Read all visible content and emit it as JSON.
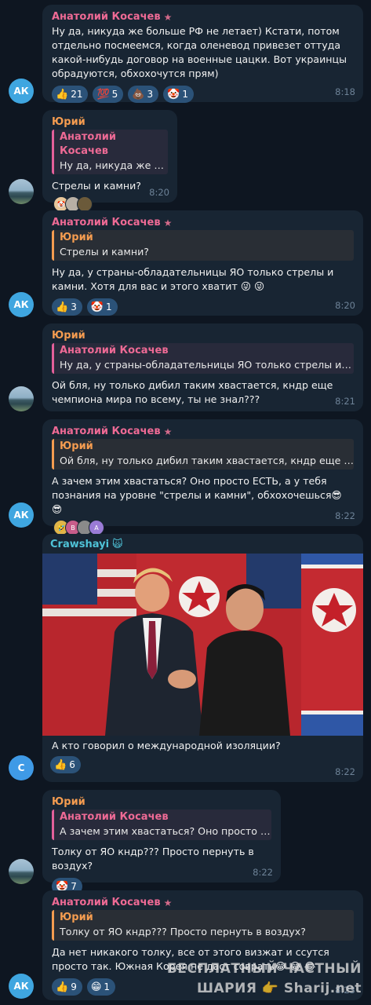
{
  "messages": [
    {
      "sender": "Анатолий Косачев",
      "avatar": "АК",
      "text": "Ну да, никуда же больше РФ не летает) Кстати, потом отдельно посмеемся, когда оленевод привезет оттуда какой-нибудь договор на военные цацки. Вот украинцы обрадуются, обхохочутся прям)",
      "reactions": [
        {
          "emoji": "👍",
          "count": "21"
        },
        {
          "emoji": "💯",
          "count": "5"
        },
        {
          "emoji": "💩",
          "count": "3"
        },
        {
          "emoji": "🤡",
          "count": "1"
        }
      ],
      "time": "8:18"
    },
    {
      "sender": "Юрий",
      "quote": {
        "name": "Анатолий Косачев",
        "text": "Ну да, никуда же бол..."
      },
      "text": "Стрелы и камни?",
      "time": "8:20"
    },
    {
      "sender": "Анатолий Косачев",
      "avatar": "АК",
      "quote": {
        "name": "Юрий",
        "text": "Стрелы и камни?"
      },
      "text": "Ну да, у страны-обладательницы ЯО только стрелы и камни. Хотя для вас и этого хватит 😜 😜",
      "reactions": [
        {
          "emoji": "👍",
          "count": "3"
        },
        {
          "emoji": "🤡",
          "count": "1"
        }
      ],
      "time": "8:20"
    },
    {
      "sender": "Юрий",
      "quote": {
        "name": "Анатолий Косачев",
        "text": "Ну да, у страны-обладательницы ЯО только стрелы и камни..."
      },
      "text": "Ой бля, ну только дибил таким хвастается, кндр еще чемпиона мира по всему, ты не знал???",
      "time": "8:21"
    },
    {
      "sender": "Анатолий Косачев",
      "avatar": "АК",
      "quote": {
        "name": "Юрий",
        "text": "Ой бля, ну только дибил таким хвастается, кндр еще чемпи..."
      },
      "text": "А зачем этим хвастаться? Оно просто ЕСТЬ, а у тебя познания на уровне \"стрелы и камни\", обхохочешься😎 😎",
      "time": "8:22"
    },
    {
      "sender": "Crawshayi",
      "sender_emoji": "🙀",
      "avatar": "C",
      "text": "А кто говорил о международной изоляции?",
      "reactions": [
        {
          "emoji": "👍",
          "count": "6"
        }
      ],
      "time": "8:22"
    },
    {
      "sender": "Юрий",
      "quote": {
        "name": "Анатолий Косачев",
        "text": "А зачем этим хвастаться? Оно просто ЕСТ..."
      },
      "text": "Толку от ЯО кндр??? Просто пернуть в воздух?",
      "reactions": [
        {
          "emoji": "🤡",
          "count": "7"
        }
      ],
      "time": "8:22"
    },
    {
      "sender": "Анатолий Косачев",
      "avatar": "АК",
      "quote": {
        "name": "Юрий",
        "text": "Толку от ЯО кндр??? Просто пернуть в воздух?"
      },
      "text": "Да нет никакого толку, все от этого визжат и ссутся просто так. Южная Корея не даст соврать😂 😂 😂",
      "reactions": [
        {
          "emoji": "👍",
          "count": "9"
        },
        {
          "emoji": "😁",
          "count": "1"
        }
      ],
      "time": "8:23"
    }
  ],
  "watermark": {
    "line1": "БЕСПЛАТНЫЙ ЧАСТНЫЙ",
    "line2": "ШАРИЯ 👉 Sharij.net"
  },
  "colors": {
    "background": "#0e1621",
    "bubble": "#182533",
    "reaction": "#2b5278",
    "accent_pink": "#ee6a95",
    "accent_orange": "#f49c50",
    "accent_teal": "#4fc3d8"
  }
}
